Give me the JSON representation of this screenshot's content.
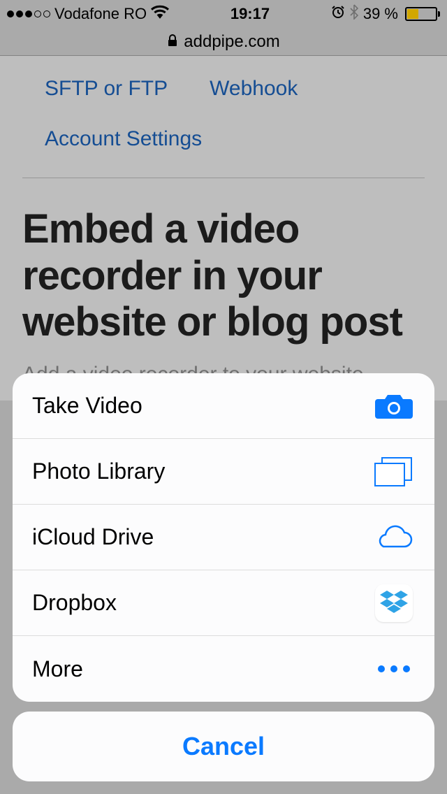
{
  "status_bar": {
    "carrier": "Vodafone RO",
    "time": "19:17",
    "battery_pct": "39 %"
  },
  "url_bar": {
    "domain": "addpipe.com"
  },
  "page": {
    "nav": {
      "link1": "SFTP or FTP",
      "link2": "Webhook",
      "link3": "Account Settings"
    },
    "headline": "Embed a video recorder in your website or blog post",
    "subhead": "Add a video recorder to your website"
  },
  "action_sheet": {
    "items": [
      {
        "label": "Take Video"
      },
      {
        "label": "Photo Library"
      },
      {
        "label": "iCloud Drive"
      },
      {
        "label": "Dropbox"
      },
      {
        "label": "More"
      }
    ],
    "cancel": "Cancel"
  }
}
